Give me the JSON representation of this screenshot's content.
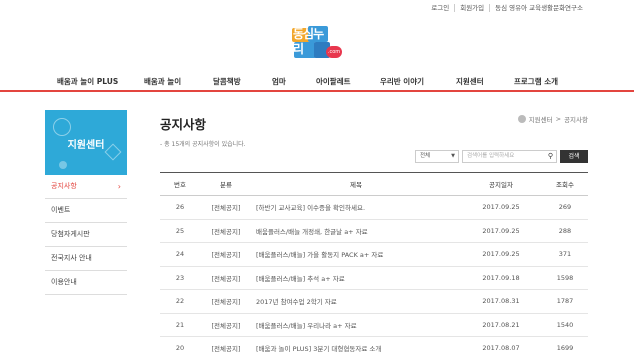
{
  "top_links": [
    "로그인",
    "회원가입",
    "동심 영유아 교육생활문화연구소"
  ],
  "logo": {
    "text": "동심누리",
    "badge": ".com"
  },
  "gnb": [
    "배움과 놀이 PLUS",
    "배움과 놀이",
    "달콤책방",
    "엄마",
    "아이팔레트",
    "우리반 이야기",
    "지원센터",
    "프로그램 소개"
  ],
  "sidebar": {
    "title": "지원센터",
    "items": [
      {
        "label": "공지사항",
        "active": true
      },
      {
        "label": "이벤트",
        "active": false
      },
      {
        "label": "당첨자게시판",
        "active": false
      },
      {
        "label": "전국지사 안내",
        "active": false
      },
      {
        "label": "이용안내",
        "active": false
      }
    ]
  },
  "page": {
    "title": "공지사항",
    "breadcrumb": [
      "지원센터",
      "공지사항"
    ],
    "count_text": "- 총 15개의 공지사항이 있습니다."
  },
  "search": {
    "select_value": "전체",
    "placeholder": "검색어를 입력하세요",
    "button": "검색"
  },
  "table": {
    "headers": [
      "번호",
      "분류",
      "제목",
      "공지일자",
      "조회수"
    ],
    "rows": [
      {
        "no": "26",
        "category": "[전체공지]",
        "title": "[하반기 교사교육] 이수증을 확인하세요.",
        "date": "2017.09.25",
        "views": "269"
      },
      {
        "no": "25",
        "category": "[전체공지]",
        "title": "배움플러스/배늘 개정쇄, 한글날 a+ 자료",
        "date": "2017.09.25",
        "views": "288"
      },
      {
        "no": "24",
        "category": "[전체공지]",
        "title": "[배움플러스/배늘] 가을 활동지 PACK a+ 자료",
        "date": "2017.09.25",
        "views": "371"
      },
      {
        "no": "23",
        "category": "[전체공지]",
        "title": "[배움플러스/배늘] 추석 a+ 자료",
        "date": "2017.09.18",
        "views": "1598"
      },
      {
        "no": "22",
        "category": "[전체공지]",
        "title": "2017년 참여수업 2학기 자료",
        "date": "2017.08.31",
        "views": "1787"
      },
      {
        "no": "21",
        "category": "[전체공지]",
        "title": "[배움플러스/배늘] 우리나라 a+ 자료",
        "date": "2017.08.21",
        "views": "1540"
      },
      {
        "no": "20",
        "category": "[전체공지]",
        "title": "[배움과 놀이 PLUS] 3분기 대형협동자료 소개",
        "date": "2017.08.07",
        "views": "1699"
      }
    ]
  },
  "colors": {
    "accent": "#e3453f",
    "sidebar_head": "#2ea9d8",
    "search_button": "#333333"
  }
}
